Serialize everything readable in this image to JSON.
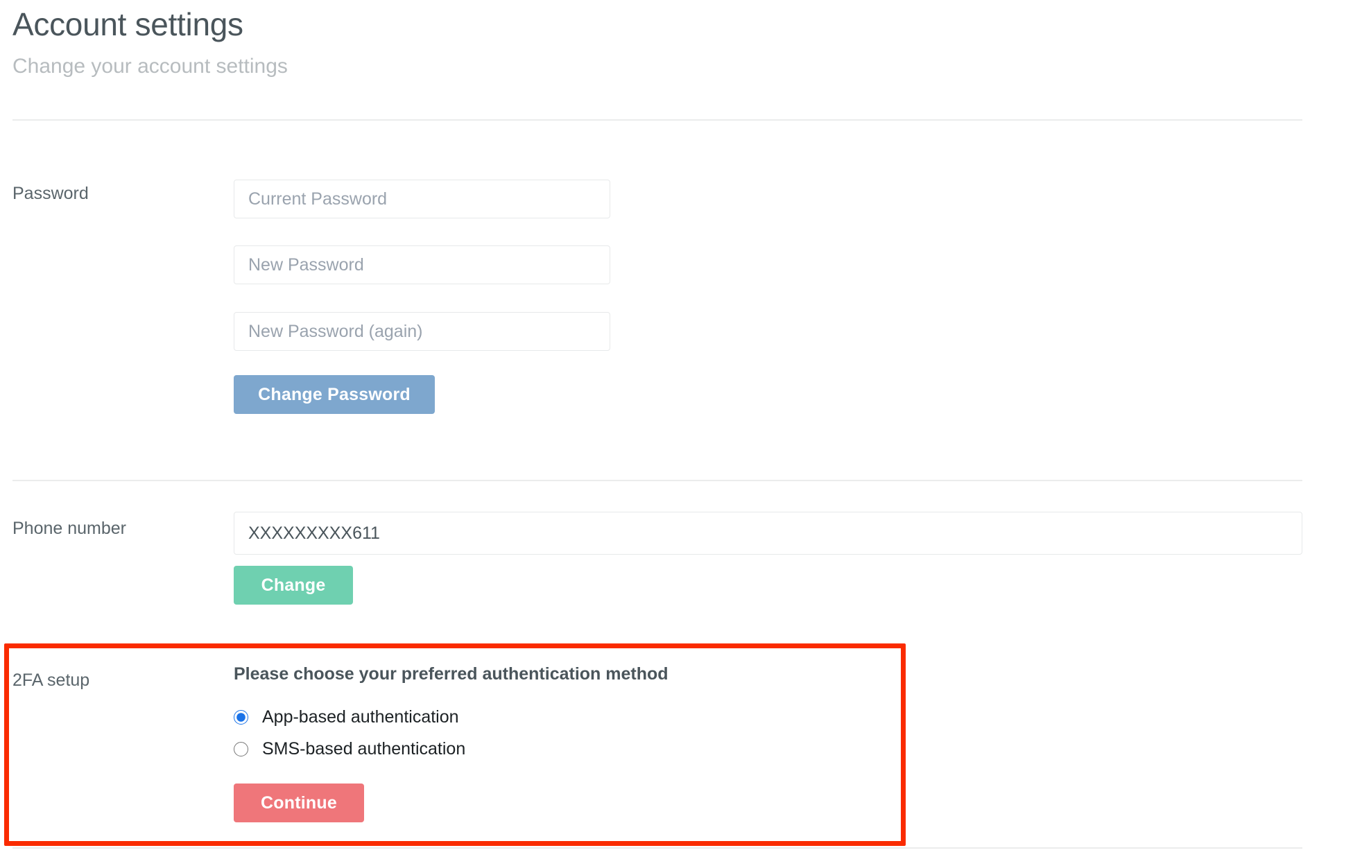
{
  "header": {
    "title": "Account settings",
    "subtitle": "Change your account settings"
  },
  "colors": {
    "title_text": "#4a555b",
    "subtitle_text": "#b7bcbf",
    "divider": "#ebecec",
    "input_border": "#e7e9ea",
    "placeholder_text": "#9aa3ae",
    "change_password_button": "#7ea7ce",
    "change_phone_button": "#6fd0b0",
    "continue_button": "#ef767a",
    "radio_selected": "#1a73e8",
    "highlight_border": "#fa2b00"
  },
  "sections": {
    "password": {
      "label": "Password",
      "fields": [
        {
          "name": "current-password",
          "value": "",
          "placeholder": "Current Password"
        },
        {
          "name": "new-password",
          "value": "",
          "placeholder": "New Password"
        },
        {
          "name": "new-password-again",
          "value": "",
          "placeholder": "New Password (again)"
        }
      ],
      "submit_label": "Change Password"
    },
    "phone": {
      "label": "Phone number",
      "field": {
        "name": "phone-number",
        "value": "XXXXXXXXX611",
        "placeholder": ""
      },
      "submit_label": "Change"
    },
    "twofa": {
      "label": "2FA setup",
      "heading": "Please choose your preferred authentication method",
      "options": [
        {
          "label": "App-based authentication",
          "value": "app",
          "selected": true
        },
        {
          "label": "SMS-based authentication",
          "value": "sms",
          "selected": false
        }
      ],
      "submit_label": "Continue"
    }
  }
}
